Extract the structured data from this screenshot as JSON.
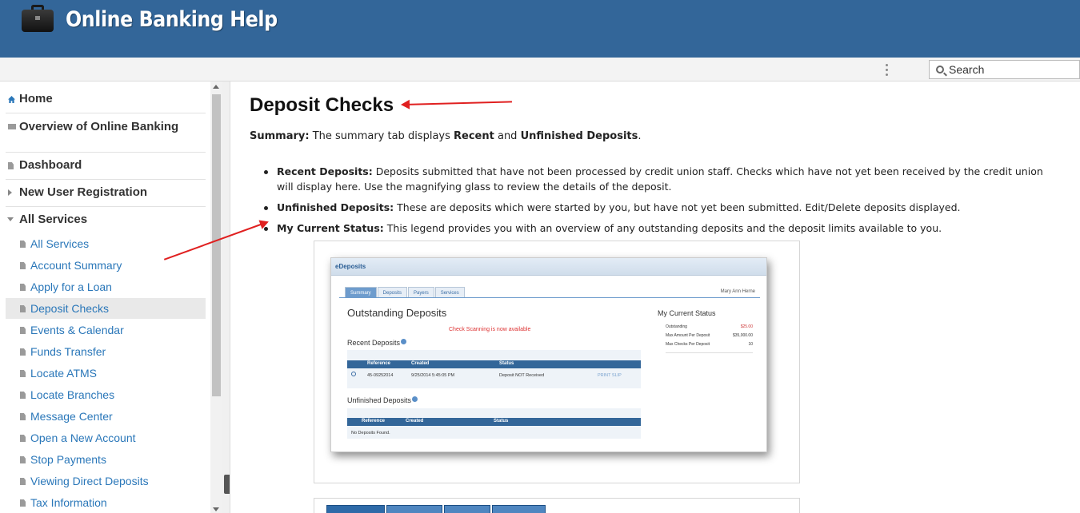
{
  "header": {
    "title": "Online Banking Help",
    "logo_icon": "briefcase-icon",
    "color": "#336699"
  },
  "toolbar": {
    "search_placeholder": "Search"
  },
  "sidebar": {
    "top_items": [
      {
        "label": "Home",
        "icon": "home-icon"
      },
      {
        "label": "Overview of Online Banking",
        "icon": "folder-icon"
      },
      {
        "label": "Dashboard",
        "icon": "document-icon"
      },
      {
        "label": "New User Registration",
        "icon": "chevron-right-icon"
      },
      {
        "label": "All Services",
        "icon": "chevron-down-icon"
      }
    ],
    "sub_items": [
      "All Services",
      "Account Summary",
      "Apply for a Loan",
      "Deposit Checks",
      "Events & Calendar",
      "Funds Transfer",
      "Locate ATMS",
      "Locate Branches",
      "Message Center",
      "Open a New Account",
      "Stop Payments",
      "Viewing Direct Deposits",
      "Tax Information"
    ],
    "active_item": "Deposit Checks"
  },
  "main": {
    "title": "Deposit Checks",
    "summary_label": "Summary:",
    "summary_text_1": " The summary tab displays ",
    "summary_bold_1": "Recent",
    "summary_text_2": " and ",
    "summary_bold_2": "Unfinished Deposits",
    "summary_text_3": ".",
    "bullets": [
      {
        "label": "Recent Deposits:",
        "text": " Deposits submitted that have not been processed by credit union staff.  Checks which have not yet been received by the credit union will display here.  Use the magnifying glass to review the details of the deposit."
      },
      {
        "label": "Unfinished Deposits:",
        "text": " These are deposits which were started by you, but have not yet been submitted.  Edit/Delete deposits displayed."
      },
      {
        "label": "My Current Status:",
        "text": " This legend provides you with an overview of any outstanding deposits and the deposit limits available to you."
      }
    ]
  },
  "screenshot": {
    "title": "eDeposits",
    "tabs": [
      "Summary",
      "Deposits",
      "Payers",
      "Services"
    ],
    "user": "Mary Ann Herne",
    "heading": "Outstanding Deposits",
    "notice": "Check Scanning is now available",
    "recent_heading": "Recent Deposits",
    "recent_cols": [
      "Reference",
      "Created",
      "Status"
    ],
    "recent_row": {
      "ref": "45-09252014",
      "created": "9/25/2014 5:45:05 PM",
      "status": "Deposit NOT Received",
      "action": "PRINT SLIP"
    },
    "unfinished_heading": "Unfinished Deposits",
    "unfinished_cols": [
      "Reference",
      "Created",
      "Status"
    ],
    "unfinished_empty": "No Deposits Found.",
    "status_heading": "My Current Status",
    "status_rows": [
      {
        "label": "Outstanding",
        "value": "$25.00"
      },
      {
        "label": "Max Amount Per Deposit",
        "value": "$35,000.00"
      },
      {
        "label": "Max Checks Per Deposit",
        "value": "10"
      }
    ]
  }
}
